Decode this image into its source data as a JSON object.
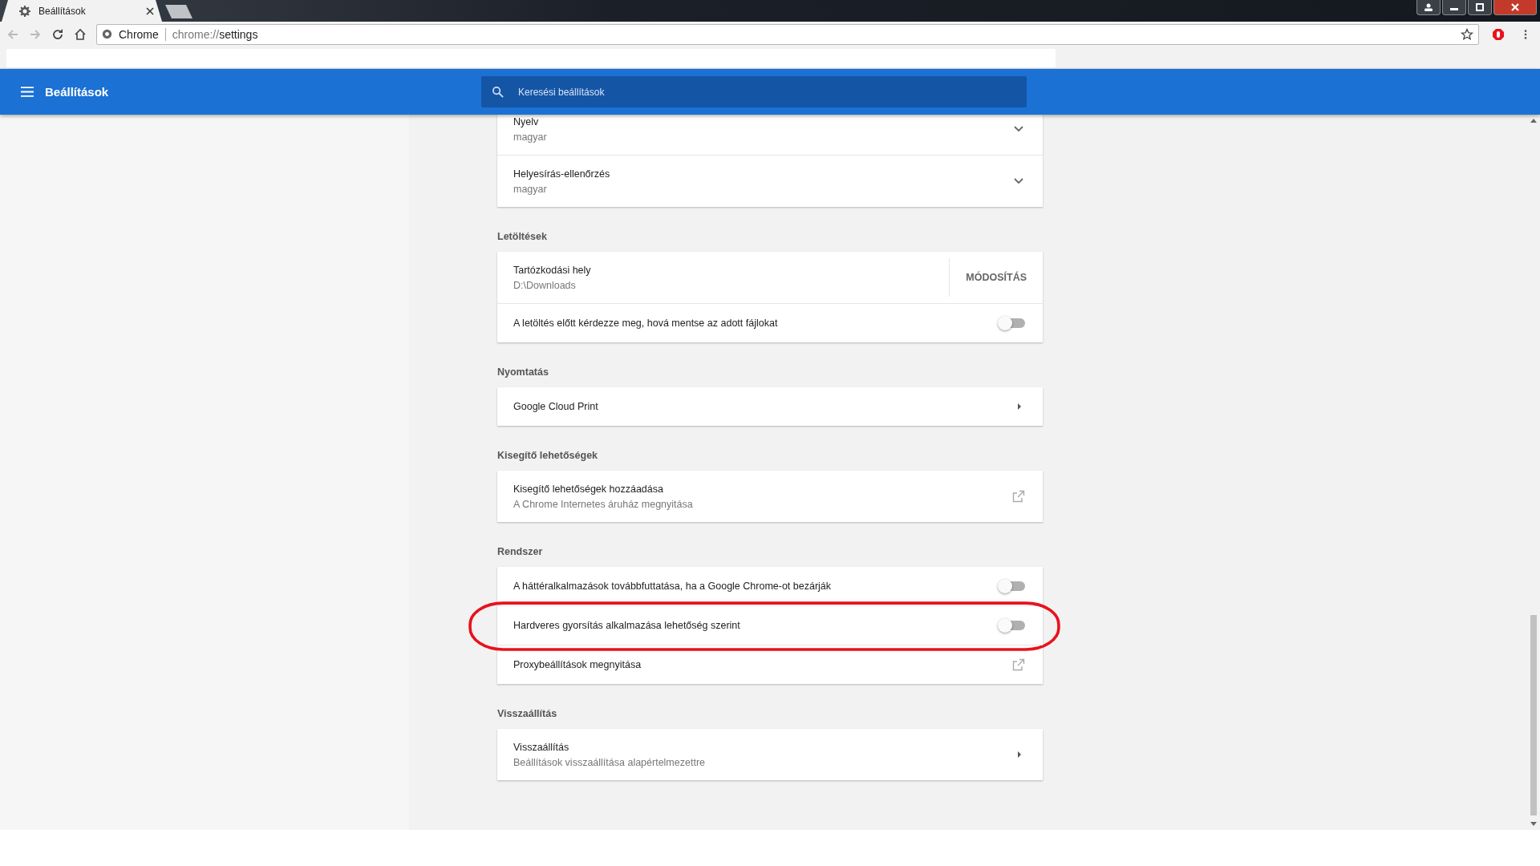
{
  "browser": {
    "tab_title": "Beállítások",
    "omnibox_origin": "Chrome",
    "url_scheme": "chrome://",
    "url_path": "settings"
  },
  "header": {
    "title": "Beállítások",
    "search": {
      "placeholder": "Keresési beállítások"
    }
  },
  "sections": [
    {
      "rows": [
        {
          "kind": "expand",
          "label": "Nyelv",
          "sublabel": "magyar",
          "circled": false
        },
        {
          "kind": "expand",
          "label": "Helyesírás-ellenőrzés",
          "sublabel": "magyar",
          "circled": false
        }
      ]
    },
    {
      "heading": "Letöltések",
      "rows": [
        {
          "kind": "button",
          "label": "Tartózkodási hely",
          "sublabel": "D:\\Downloads",
          "button": "MÓDOSÍTÁS",
          "circled": false
        },
        {
          "kind": "toggle",
          "label": "A letöltés előtt kérdezze meg, hová mentse az adott fájlokat",
          "on": false,
          "circled": false
        }
      ]
    },
    {
      "heading": "Nyomtatás",
      "rows": [
        {
          "kind": "arrow",
          "label": "Google Cloud Print",
          "circled": false
        }
      ]
    },
    {
      "heading": "Kisegítő lehetőségek",
      "rows": [
        {
          "kind": "external",
          "label": "Kisegítő lehetőségek hozzáadása",
          "sublabel": "A Chrome Internetes áruház megnyitása",
          "circled": false
        }
      ]
    },
    {
      "heading": "Rendszer",
      "rows": [
        {
          "kind": "toggle",
          "label": "A háttéralkalmazások továbbfuttatása, ha a Google Chrome-ot bezárják",
          "on": false,
          "circled": false
        },
        {
          "kind": "toggle",
          "label": "Hardveres gyorsítás alkalmazása lehetőség szerint",
          "on": false,
          "circled": true
        },
        {
          "kind": "external",
          "label": "Proxybeállítások megnyitása",
          "circled": false
        }
      ]
    },
    {
      "heading": "Visszaállítás",
      "rows": [
        {
          "kind": "arrow",
          "label": "Visszaállítás",
          "sublabel": "Beállítások visszaállítása alapértelmezettre",
          "circled": false
        }
      ]
    }
  ]
}
